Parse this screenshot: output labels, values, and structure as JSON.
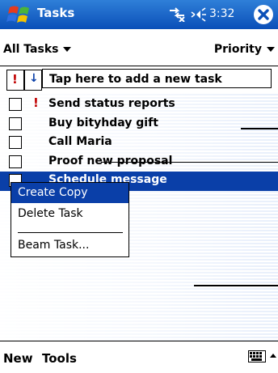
{
  "titlebar": {
    "app_title": "Tasks",
    "clock": "3:32",
    "icons": [
      "windows-start-icon",
      "connectivity-icon",
      "volume-icon",
      "close-icon"
    ]
  },
  "filter": {
    "label": "All Tasks"
  },
  "sort": {
    "label": "Priority"
  },
  "entry_bar": {
    "priority_symbol": "!",
    "low_symbol": "↓",
    "placeholder": "Tap here to add a new task"
  },
  "tasks": [
    {
      "text": "Send status reports",
      "high_priority": true,
      "selected": false
    },
    {
      "text": "Buy bityhday gift",
      "high_priority": false,
      "selected": false
    },
    {
      "text": "Call Maria",
      "high_priority": false,
      "selected": false
    },
    {
      "text": "Proof new proposal",
      "high_priority": false,
      "selected": false
    },
    {
      "text": "Schedule message",
      "high_priority": false,
      "selected": true
    }
  ],
  "context_menu": {
    "items": [
      "Create Copy",
      "Delete Task",
      "Beam Task..."
    ],
    "highlighted": "Create Copy"
  },
  "bottom_bar": {
    "new_label": "New",
    "tools_label": "Tools"
  },
  "colors": {
    "title_bar": "#0a4fb8",
    "selection": "#0a3fa8",
    "priority_red": "#c00000"
  }
}
